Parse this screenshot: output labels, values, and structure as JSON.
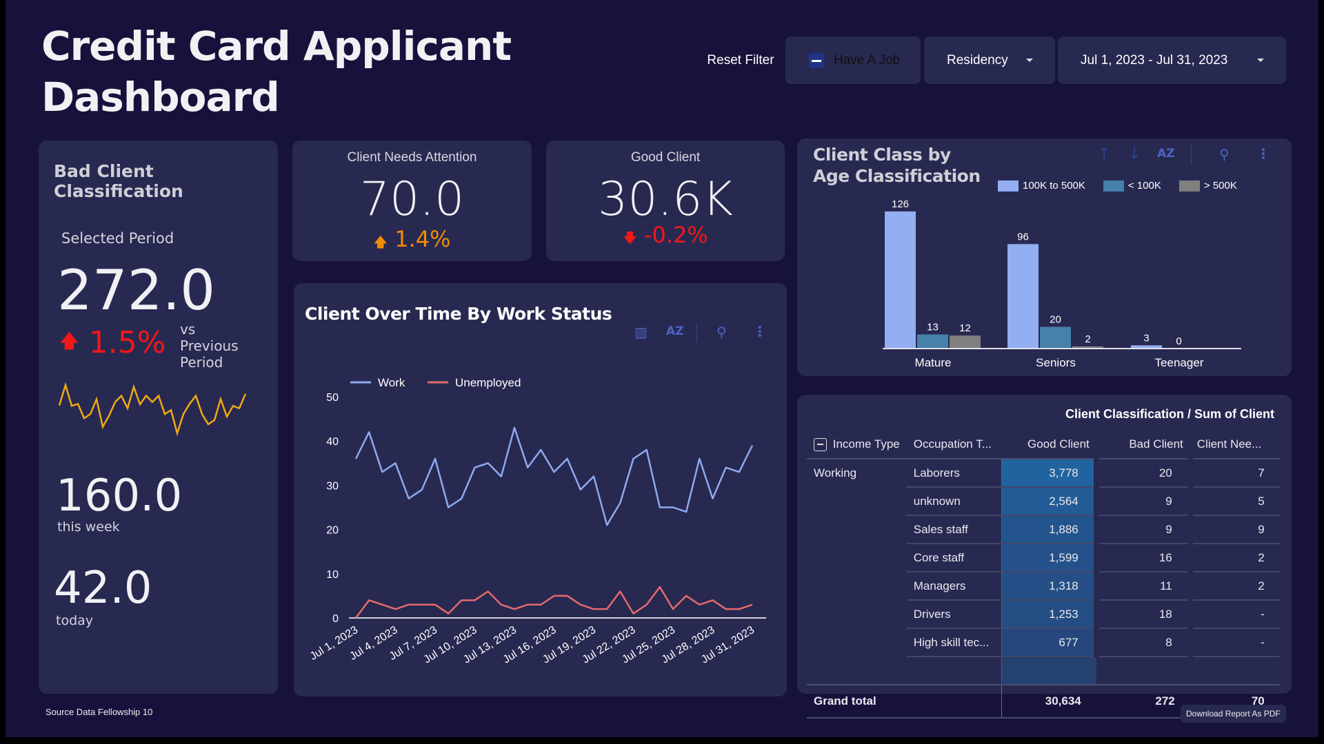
{
  "header": {
    "title_line1": "Credit Card Applicant",
    "title_line2": "Dashboard"
  },
  "filters": {
    "reset_label": "Reset Filter",
    "have_job_label": "Have A Job",
    "residency_label": "Residency",
    "date_range": "Jul 1, 2023 - Jul 31, 2023"
  },
  "bad_client": {
    "title": "Bad Client Classification",
    "period_label": "Selected Period",
    "value": "272.0",
    "delta": "1.5%",
    "delta_color": "#f01818",
    "vs_label_1": "vs",
    "vs_label_2": "Previous Period",
    "sparkline_color": "#f0aa14",
    "sparkline": [
      13.5,
      22.3,
      13.3,
      14.2,
      8,
      9.8,
      16.2,
      4.3,
      9,
      15,
      17.7,
      12.3,
      21.5,
      14,
      17.7,
      15,
      17.7,
      9.8,
      11.5,
      1.5,
      9.8,
      14.2,
      17.7,
      9.8,
      5.4,
      7.2,
      16.3,
      8.7,
      13.3,
      12.3,
      18.5
    ],
    "week_value": "160.0",
    "week_label": "this week",
    "today_value": "42.0",
    "today_label": "today"
  },
  "kpi_attention": {
    "title": "Client Needs Attention",
    "value": "70.0",
    "delta": "1.4%",
    "delta_color": "#f08c00"
  },
  "kpi_good": {
    "title": "Good Client",
    "value": "30.6K",
    "delta": "-0.2%",
    "delta_color": "#f01818"
  },
  "footer": {
    "source": "Source Data Fellowship 10",
    "download_label": "Download Report As PDF"
  },
  "chart_data": [
    {
      "type": "line",
      "title": "Client Over Time By Work Status",
      "x": [
        "Jul 1, 2023",
        "Jul 2, 2023",
        "Jul 3, 2023",
        "Jul 4, 2023",
        "Jul 5, 2023",
        "Jul 6, 2023",
        "Jul 7, 2023",
        "Jul 8, 2023",
        "Jul 9, 2023",
        "Jul 10, 2023",
        "Jul 11, 2023",
        "Jul 12, 2023",
        "Jul 13, 2023",
        "Jul 14, 2023",
        "Jul 15, 2023",
        "Jul 16, 2023",
        "Jul 17, 2023",
        "Jul 18, 2023",
        "Jul 19, 2023",
        "Jul 20, 2023",
        "Jul 21, 2023",
        "Jul 22, 2023",
        "Jul 23, 2023",
        "Jul 24, 2023",
        "Jul 25, 2023",
        "Jul 26, 2023",
        "Jul 27, 2023",
        "Jul 28, 2023",
        "Jul 29, 2023",
        "Jul 30, 2023",
        "Jul 31, 2023"
      ],
      "xticks": [
        "Jul 1, 2023",
        "Jul 4, 2023",
        "Jul 7, 2023",
        "Jul 10, 2023",
        "Jul 13, 2023",
        "Jul 16, 2023",
        "Jul 19, 2023",
        "Jul 22, 2023",
        "Jul 25, 2023",
        "Jul 28, 2023",
        "Jul 31, 2023"
      ],
      "series": [
        {
          "name": "Work",
          "color": "#8faaf0",
          "values": [
            36,
            42,
            33,
            35,
            27,
            29,
            36,
            25,
            27,
            34,
            35,
            32,
            43,
            34,
            38,
            33,
            36,
            29,
            32,
            21,
            26,
            36,
            38,
            25,
            25,
            24,
            36,
            27,
            34,
            33,
            39
          ]
        },
        {
          "name": "Unemployed",
          "color": "#e46b6b",
          "values": [
            0,
            4,
            3,
            2,
            3,
            3,
            3,
            1,
            4,
            4,
            6,
            3,
            2,
            3,
            3,
            5,
            5,
            3,
            2,
            2,
            6,
            1,
            3,
            7,
            2,
            5,
            3,
            4,
            2,
            2,
            3
          ]
        }
      ],
      "yticks": [
        0,
        10,
        20,
        30,
        40,
        50
      ],
      "ylim": [
        0,
        50
      ],
      "xlabel": "",
      "ylabel": "",
      "legend": "top-left",
      "grid": false
    },
    {
      "type": "bar",
      "title": "Client Class by Age Classification",
      "categories": [
        "Mature",
        "Seniors",
        "Teenager"
      ],
      "series": [
        {
          "name": "100K to 500K",
          "color": "#93aef2",
          "values": [
            126,
            96,
            3
          ]
        },
        {
          "name": "< 100K",
          "color": "#4681aa",
          "values": [
            13,
            20,
            0
          ]
        },
        {
          "name": "> 500K",
          "color": "#808080",
          "values": [
            12,
            2,
            null
          ]
        }
      ],
      "ylim": [
        0,
        130
      ],
      "legend": "top-right",
      "grid": false
    },
    {
      "type": "table",
      "title": "Client Classification / Sum of Client",
      "columns": [
        "Income Type",
        "Occupation T...",
        "Good Client",
        "Bad Client",
        "Client Nee..."
      ],
      "group": "Working",
      "rows": [
        [
          "Laborers",
          "3,778",
          "20",
          "7"
        ],
        [
          "unknown",
          "2,564",
          "9",
          "5"
        ],
        [
          "Sales staff",
          "1,886",
          "9",
          "9"
        ],
        [
          "Core staff",
          "1,599",
          "16",
          "2"
        ],
        [
          "Managers",
          "1,318",
          "11",
          "2"
        ],
        [
          "Drivers",
          "1,253",
          "18",
          "-"
        ],
        [
          "High skill tec...",
          "677",
          "8",
          "-"
        ]
      ],
      "heat": [
        1.0,
        0.75,
        0.55,
        0.45,
        0.35,
        0.32,
        0.15
      ],
      "total": [
        "Grand total",
        "30,634",
        "272",
        "70"
      ]
    }
  ]
}
